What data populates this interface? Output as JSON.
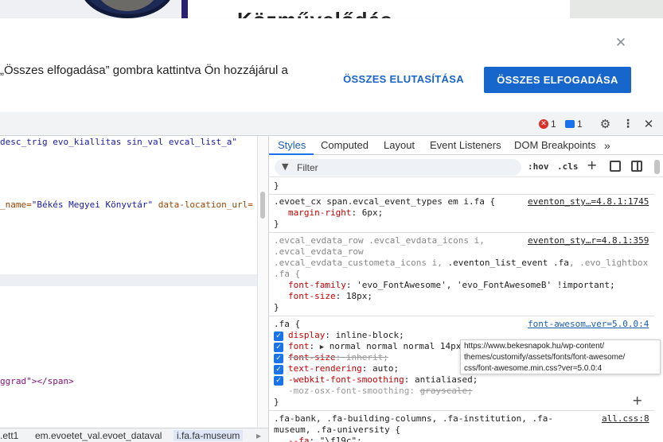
{
  "site": {
    "heading": "Közművelődés"
  },
  "cookie": {
    "text": "„Összes elfogadása” gombra kattintva Ön hozzájárul a",
    "reject_label": "ÖSSZES ELUTASÍTÁSA",
    "accept_label": "ÖSSZES ELFOGADÁSA",
    "close_icon": "close-icon",
    "colors": {
      "accent": "#1766cc"
    }
  },
  "devtools": {
    "errors": "1",
    "messages": "1",
    "elements": {
      "line1": "desc_trig evo_kiallitas sin_val evcal_list_a\"",
      "line2_attr": "_name=",
      "line2_val": "\"Békés Megyei Könyvtár\"",
      "line2_attr2": " data-location_url=",
      "line3": "ggrad\"></span>"
    },
    "breadcrumbs": [
      ".ett1",
      "em.evoetet_val.evoet_dataval",
      "i.fa.fa-museum"
    ],
    "tabs": [
      "Styles",
      "Computed",
      "Layout",
      "Event Listeners",
      "DOM Breakpoints",
      "»"
    ],
    "filter_placeholder": "Filter",
    "hov_label": ":hov",
    "cls_label": ".cls",
    "rules": {
      "r0_close": "}",
      "r1_selector": ".evoet_cx span.evcal_event_types em i.fa {",
      "r1_source": "eventon_sty…=4.8.1:1745",
      "r1_prop": "margin-right",
      "r1_val": "6px;",
      "r1_close": "}",
      "r2_sel1": ".evcal_evdata_row .evcal_evdata_icons i,",
      "r2_source": "eventon_sty…r=4.8.1:359",
      "r2_sel2": ".evcal_evdata_row",
      "r2_sel3a": ".evcal_evdata_custometa_icons i, ",
      "r2_sel3b": ".eventon_list_event .fa",
      "r2_sel3c": ", .evo_lightbox",
      "r2_sel4": ".fa {",
      "r2_p1": "font-family",
      "r2_v1": "'evo_FontAwesome', 'evo_FontAwesomeB' !important;",
      "r2_p2": "font-size",
      "r2_v2": "18px;",
      "r2_close": "}",
      "r3_selector": ".fa {",
      "r3_source": "font-awesom…ver=5.0.0:4",
      "r3_p1": "display",
      "r3_v1": "inline-block;",
      "r3_p2": "font",
      "r3_v2": "normal normal normal 14px",
      "r3_p3": "font-size",
      "r3_v3": "inherit;",
      "r3_p4": "text-rendering",
      "r3_v4": "auto;",
      "r3_p5": "-webkit-font-smoothing",
      "r3_v5": "antialiased;",
      "r3_p6": "-moz-osx-font-smoothing",
      "r3_v6": "grayscale;",
      "r3_close": "}",
      "r4_sel1": ".fa-bank, .fa-building-columns, .fa-institution, .fa-",
      "r4_source": "all.css:8",
      "r4_sel2": "museum, .fa-university {",
      "r4_p1": "--fa",
      "r4_v1": "\"\\f19c\";"
    },
    "tooltip": {
      "line1": "https://www.bekesnapok.hu/wp-content/",
      "line2": "themes/customify/assets/fonts/font-awesome/",
      "line3": "css/font-awesome.min.css?ver=5.0.0:4"
    }
  }
}
